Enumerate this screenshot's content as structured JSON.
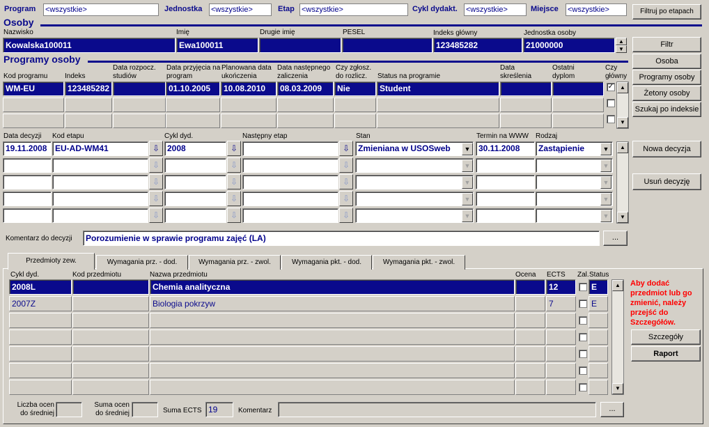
{
  "filter": {
    "program_label": "Program",
    "program_val": "<wszystkie>",
    "jednostka_label": "Jednostka",
    "jednostka_val": "<wszystkie>",
    "etap_label": "Etap",
    "etap_val": "<wszystkie>",
    "cykl_label": "Cykl dydakt.",
    "cykl_val": "<wszystkie>",
    "miejsce_label": "Miejsce",
    "miejsce_val": "<wszystkie>",
    "filtruj_btn": "Filtruj po etapach"
  },
  "osoby": {
    "title": "Osoby",
    "nazwisko_label": "Nazwisko",
    "nazwisko": "Kowalska100011",
    "imie_label": "Imię",
    "imie": "Ewa100011",
    "drugie_label": "Drugie imię",
    "drugie": "",
    "pesel_label": "PESEL",
    "pesel": "",
    "indeks_label": "Indeks główny",
    "indeks": "123485282",
    "jedn_label": "Jednostka osoby",
    "jedn": "21000000"
  },
  "side": {
    "filtr": "Filtr",
    "osoba": "Osoba",
    "programy": "Programy osoby",
    "zetony": "Żetony osoby",
    "szukaj": "Szukaj po indeksie",
    "nowa": "Nowa decyzja",
    "usun": "Usuń decyzję"
  },
  "programy": {
    "title": "Programy osoby",
    "h_kod": "Kod programu",
    "h_indeks": "Indeks",
    "h_data_rozp": "Data rozpocz. studiów",
    "h_data_przyj": "Data przyjęcia na program",
    "h_plan": "Planowana data ukończenia",
    "h_nast": "Data następnego zaliczenia",
    "h_zgl": "Czy zgłosz. do rozlicz.",
    "h_status": "Status na programie",
    "h_skresl": "Data skreślenia",
    "h_ostatni": "Ostatni dyplom",
    "h_glowny": "Czy główny",
    "row": {
      "kod": "WM-EU",
      "indeks": "123485282",
      "rozp": "",
      "przyj": "01.10.2005",
      "plan": "10.08.2010",
      "nast": "08.03.2009",
      "zgl": "Nie",
      "status": "Student",
      "skresl": "",
      "ostatni": ""
    }
  },
  "decyzje": {
    "h_data": "Data decyzji",
    "h_kod": "Kod etapu",
    "h_cykl": "Cykl dyd.",
    "h_nast": "Następny etap",
    "h_stan": "Stan",
    "h_termin": "Termin na WWW",
    "h_rodzaj": "Rodzaj",
    "row": {
      "data": "19.11.2008",
      "kod": "EU-AD-WM41",
      "cykl": "2008",
      "nast": "",
      "stan": "Zmieniana w USOSweb",
      "termin": "30.11.2008",
      "rodzaj": "Zastąpienie"
    },
    "komentarz_label": "Komentarz  do decyzji",
    "komentarz": "Porozumienie w sprawie programu zajęć (LA)",
    "more": "..."
  },
  "tabs": [
    "Przedmioty zew.",
    "Wymagania prz. - dod.",
    "Wymagania prz. - zwol.",
    "Wymagania pkt. - dod.",
    "Wymagania pkt. - zwol."
  ],
  "przedmioty": {
    "h_cykl": "Cykl dyd.",
    "h_kod": "Kod przedmiotu",
    "h_nazwa": "Nazwa przedmiotu",
    "h_ocena": "Ocena",
    "h_ects": "ECTS",
    "h_zal": "Zal.",
    "h_status": "Status",
    "rows": [
      {
        "cykl": "2008L",
        "kod": "",
        "nazwa": "Chemia analityczna",
        "ocena": "",
        "ects": "12",
        "status": "E"
      },
      {
        "cykl": "2007Z",
        "kod": "",
        "nazwa": "Biologia pokrzyw",
        "ocena": "",
        "ects": "7",
        "status": "E"
      }
    ],
    "warning": "Aby dodać przedmiot lub go zmienić, należy przejść do Szczegółów.",
    "szczegoly": "Szczegóły",
    "raport": "Raport"
  },
  "footer": {
    "liczba_label": "Liczba ocen do średniej",
    "liczba": "",
    "suma_label": "Suma ocen do średniej",
    "suma": "",
    "ects_label": "Suma ECTS",
    "ects": "19",
    "kom_label": "Komentarz",
    "kom": "",
    "more": "..."
  },
  "colors": {
    "accent": "#0a0a8c",
    "warning": "#ff0000"
  }
}
